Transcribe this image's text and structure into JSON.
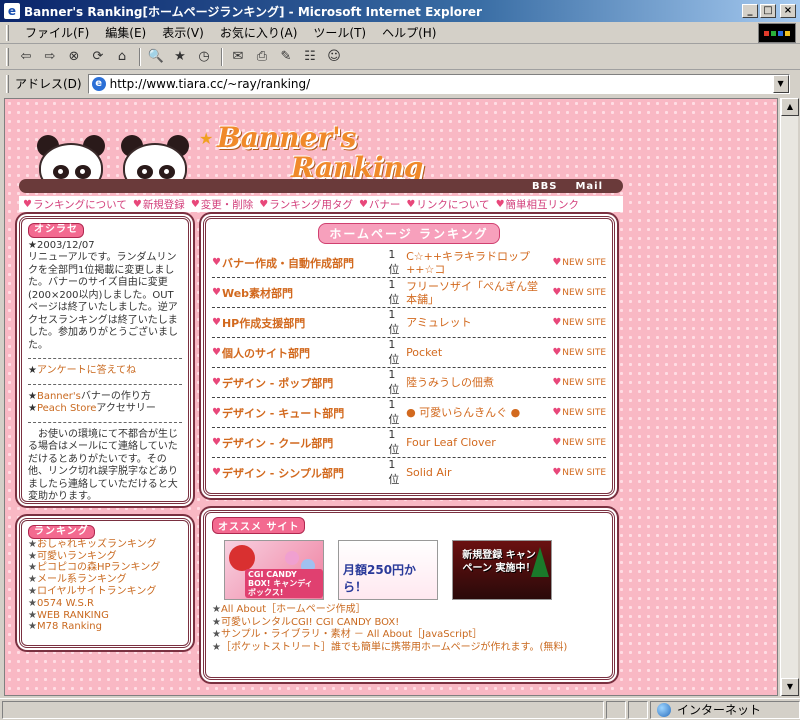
{
  "window": {
    "title": "Banner's Ranking[ホームページランキング] - Microsoft Internet Explorer",
    "icon_char": "e",
    "controls": {
      "minimize": "_",
      "maximize": "□",
      "close": "×"
    }
  },
  "menu": [
    "ファイル(F)",
    "編集(E)",
    "表示(V)",
    "お気に入り(A)",
    "ツール(T)",
    "ヘルプ(H)"
  ],
  "toolbar": {
    "back": "⇦",
    "forward": "⇨",
    "stop": "⊗",
    "refresh": "⟳",
    "home": "⌂",
    "search": "🔍",
    "favorites": "★",
    "history": "◷",
    "mail": "✉",
    "print": "⎙",
    "edit": "✎",
    "discuss": "☷",
    "messenger": "☺"
  },
  "address": {
    "label": "アドレス(D)",
    "url": "http://www.tiara.cc/~ray/ranking/"
  },
  "status": {
    "zone": "インターネット"
  },
  "header": {
    "logo_line1": "Banner's",
    "logo_line2": "Ranking",
    "bbs": "BBS",
    "mail": "Mail"
  },
  "nav": [
    "ランキングについて",
    "新規登録",
    "変更・削除",
    "ランキング用タグ",
    "バナー",
    "リンクについて",
    "簡単相互リンク"
  ],
  "news": {
    "title": "オシラセ",
    "date": "★2003/12/07",
    "body": "リニューアルです。ランダムリンクを全部門1位掲載に変更しました。バナーのサイズ自由に変更(200×200以内)しました。OUTページは終了いたしました。逆アクセスランキングは終了いたしました。参加ありがとうございました。",
    "survey_star": "★",
    "survey_link": "アンケートに答えてね",
    "link1_star": "★",
    "link1": "Banner's",
    "link1_suffix": "バナーの作り方",
    "link2_star": "★",
    "link2": "Peach Store",
    "link2_suffix": "アクセサリー",
    "notice": "　お使いの環境にて不都合が生じる場合はメールにて連絡していただけるとありがたいです。その他、リンク切れ誤字脱字などありましたら連絡していただけると大変助かります。"
  },
  "ranklist": {
    "title": "ランキング",
    "items": [
      "おしゃれキッズランキング",
      "可愛いランキング",
      "ピコピコの森HPランキング",
      "メール系ランキング",
      "ロイヤルサイトランキング",
      "0574 W.S.R",
      "WEB RANKING",
      "M78 Ranking"
    ]
  },
  "hpr": {
    "title": "ホームページ ランキング",
    "rows": [
      {
        "category": "バナー作成・自動作成部門",
        "rank": "1位",
        "site": "C☆++キラキラドロップ++☆コ",
        "new": "NEW SITE"
      },
      {
        "category": "Web素材部門",
        "rank": "1位",
        "site": "フリーソザイ「ぺんぎん堂本舗」",
        "new": "NEW SITE"
      },
      {
        "category": "HP作成支援部門",
        "rank": "1位",
        "site": "アミュレット",
        "new": "NEW SITE"
      },
      {
        "category": "個人のサイト部門",
        "rank": "1位",
        "site": "Pocket",
        "new": "NEW SITE"
      },
      {
        "category": "デザイン - ポップ部門",
        "rank": "1位",
        "site": "陸うみうしの佃煮",
        "new": "NEW SITE"
      },
      {
        "category": "デザイン - キュート部門",
        "rank": "1位",
        "site": "● 可愛いらんきんぐ ●",
        "new": "NEW SITE"
      },
      {
        "category": "デザイン - クール部門",
        "rank": "1位",
        "site": "Four Leaf Clover",
        "new": "NEW SITE"
      },
      {
        "category": "デザイン - シンプル部門",
        "rank": "1位",
        "site": "Solid  Air",
        "new": "NEW SITE"
      }
    ]
  },
  "recommended": {
    "title": "オススメ サイト",
    "banner1": "CGI CANDY BOX! キャンディボックス!",
    "banner2": "月額250円から！",
    "banner3": "新規登録 キャンペーン 実施中！",
    "links": [
      "All About［ホームページ作成］",
      "可愛いレンタルCGI!  CGI CANDY BOX!",
      "サンプル・ライブラリ・素材 － All About［JavaScript］",
      "［ポケットストリート］誰でも簡単に携帯用ホームページが作れます。(無料)"
    ]
  },
  "colors": {
    "accent": "#d2691e",
    "pink_bg": "#f9b8c4",
    "border": "#7a3040"
  }
}
